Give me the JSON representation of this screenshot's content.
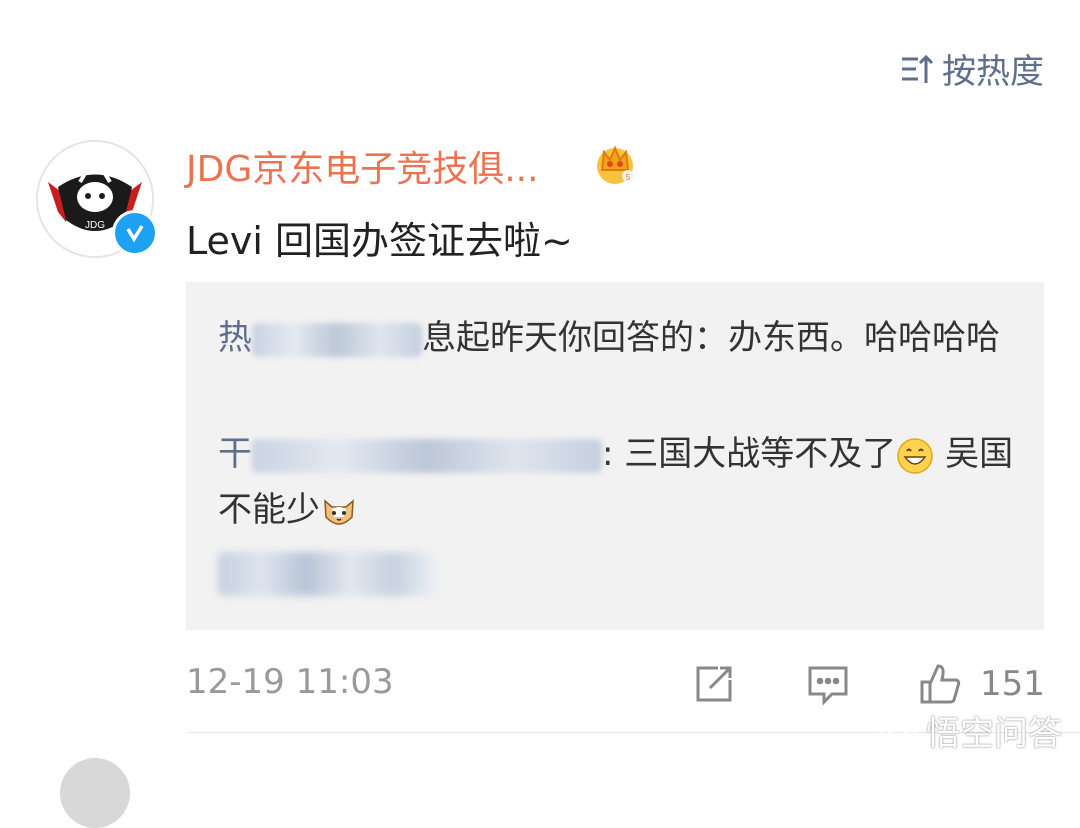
{
  "sort": {
    "label": "按热度"
  },
  "post": {
    "username": "JDG京东电子竞技俱...",
    "text": "Levi 回国办签证去啦~",
    "time": "12-19 11:03",
    "like_count": "151"
  },
  "replies": [
    {
      "user_visible": "热",
      "text": "息起昨天你回答的：办东西。哈哈哈哈"
    },
    {
      "user_visible": "干",
      "text": "三国大战等不及了",
      "text2": "吴国不能少"
    }
  ],
  "watermark": {
    "label": "悟空问答"
  },
  "colors": {
    "username": "#eb7350",
    "link": "#5e6f8e",
    "reply_bg": "#f2f2f2",
    "verified": "#1da1f2"
  }
}
